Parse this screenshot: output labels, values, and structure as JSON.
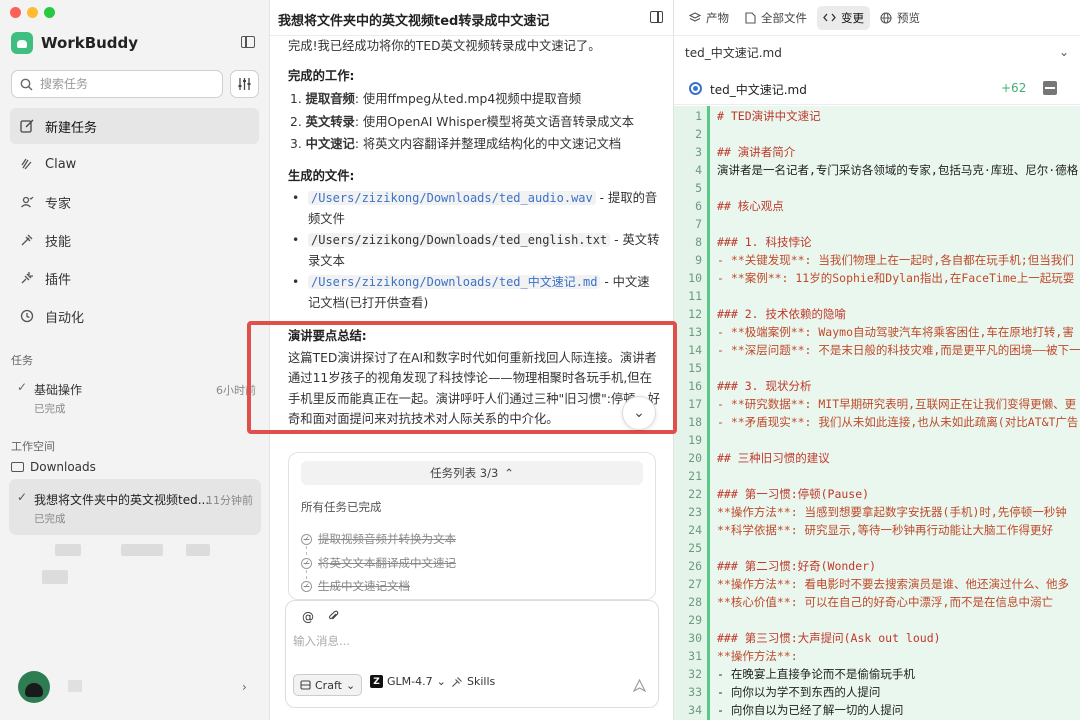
{
  "sidebar": {
    "brand": "WorkBuddy",
    "search_placeholder": "搜索任务",
    "nav": [
      {
        "label": "新建任务",
        "icon": "edit-icon"
      },
      {
        "label": "Claw",
        "icon": "claw-icon"
      },
      {
        "label": "专家",
        "icon": "experts-icon"
      },
      {
        "label": "技能",
        "icon": "skills-icon"
      },
      {
        "label": "插件",
        "icon": "plugin-icon"
      },
      {
        "label": "自动化",
        "icon": "clock-icon"
      }
    ],
    "tasks_label": "任务",
    "task": {
      "title": "基础操作",
      "time": "6小时前",
      "status": "已完成"
    },
    "workspace_label": "工作空间",
    "folder": "Downloads",
    "session": {
      "title": "我想将文件夹中的英文视频ted...",
      "time": "11分钟前",
      "status": "已完成"
    }
  },
  "chat": {
    "title": "我想将文件夹中的英文视频ted转录成中文速记",
    "intro": "完成!我已经成功将你的TED英文视频转录成中文速记了。",
    "work_heading": "完成的工作:",
    "steps": [
      {
        "num": "1.",
        "bold": "提取音频",
        "text": ": 使用ffmpeg从ted.mp4视频中提取音频"
      },
      {
        "num": "2.",
        "bold": "英文转录",
        "text": ": 使用OpenAI Whisper模型将英文语音转录成文本"
      },
      {
        "num": "3.",
        "bold": "中文速记",
        "text": ": 将英文内容翻译并整理成结构化的中文速记文档"
      }
    ],
    "files_heading": "生成的文件:",
    "files": [
      {
        "path": "/Users/zizikong/Downloads/ted_audio.wav",
        "desc": " - 提取的音频文件"
      },
      {
        "path": "/Users/zizikong/Downloads/ted_english.txt",
        "desc": " - 英文转录文本"
      },
      {
        "path": "/Users/zizikong/Downloads/ted_中文速记.md",
        "desc": " - 中文速记文档(已打开供查看)"
      }
    ],
    "summary_heading": "演讲要点总结:",
    "summary_text": "这篇TED演讲探讨了在AI和数字时代如何重新找回人际连接。演讲者通过11岁孩子的视角发现了科技悖论——物理相聚时各玩手机,但在手机里反而能真正在一起。演讲呼吁人们通过三种\"旧习惯\":停顿、好奇和面对面提问来对抗技术对人际关系的中介化。",
    "task_card": {
      "header": "任务列表 3/3",
      "status": "所有任务已完成",
      "items": [
        "提取视频音频并转换为文本",
        "将英文文本翻译成中文速记",
        "生成中文速记文档"
      ]
    },
    "composer": {
      "placeholder": "输入消息...",
      "mode": "Craft",
      "model": "GLM-4.7",
      "skills": "Skills"
    }
  },
  "right": {
    "tabs": [
      {
        "label": "产物",
        "icon": "layers-icon",
        "active": false
      },
      {
        "label": "全部文件",
        "icon": "file-icon",
        "active": false
      },
      {
        "label": "变更",
        "icon": "code-icon",
        "active": true
      },
      {
        "label": "预览",
        "icon": "globe-icon",
        "active": false
      }
    ],
    "selected_file": "ted_中文速记.md",
    "file_name": "ted_中文速记.md",
    "additions": "+62",
    "lines": [
      {
        "n": "1",
        "t": "# TED演讲中文速记",
        "k": "h"
      },
      {
        "n": "2",
        "t": "",
        "k": ""
      },
      {
        "n": "3",
        "t": "## 演讲者简介",
        "k": "h"
      },
      {
        "n": "4",
        "t": "演讲者是一名记者,专门采访各领域的专家,包括马克·库班、尼尔·德格",
        "k": ""
      },
      {
        "n": "5",
        "t": "",
        "k": ""
      },
      {
        "n": "6",
        "t": "## 核心观点",
        "k": "h"
      },
      {
        "n": "7",
        "t": "",
        "k": ""
      },
      {
        "n": "8",
        "t": "### 1. 科技悖论",
        "k": "h"
      },
      {
        "n": "9",
        "t": "- **关键发现**: 当我们物理上在一起时,各自都在玩手机;但当我们",
        "k": "b"
      },
      {
        "n": "10",
        "t": "- **案例**: 11岁的Sophie和Dylan指出,在FaceTime上一起玩耍",
        "k": "b"
      },
      {
        "n": "11",
        "t": "",
        "k": ""
      },
      {
        "n": "12",
        "t": "### 2. 技术依赖的隐喻",
        "k": "h"
      },
      {
        "n": "13",
        "t": "- **极端案例**: Waymo自动驾驶汽车将乘客困住,车在原地打转,害",
        "k": "b"
      },
      {
        "n": "14",
        "t": "- **深层问题**: 不是末日般的科技灾难,而是更平凡的困境——被下一",
        "k": "b"
      },
      {
        "n": "15",
        "t": "",
        "k": ""
      },
      {
        "n": "16",
        "t": "### 3. 现状分析",
        "k": "h"
      },
      {
        "n": "17",
        "t": "- **研究数据**: MIT早期研究表明,互联网正在让我们变得更懒、更",
        "k": "b"
      },
      {
        "n": "18",
        "t": "- **矛盾现实**: 我们从未如此连接,也从未如此疏离(对比AT&T广告",
        "k": "b"
      },
      {
        "n": "19",
        "t": "",
        "k": ""
      },
      {
        "n": "20",
        "t": "## 三种旧习惯的建议",
        "k": "h"
      },
      {
        "n": "21",
        "t": "",
        "k": ""
      },
      {
        "n": "22",
        "t": "### 第一习惯:停顿(Pause)",
        "k": "h"
      },
      {
        "n": "23",
        "t": "**操作方法**: 当感到想要拿起数字安抚器(手机)时,先停顿一秒钟",
        "k": "b"
      },
      {
        "n": "24",
        "t": "**科学依据**: 研究显示,等待一秒钟再行动能让大脑工作得更好",
        "k": "b"
      },
      {
        "n": "25",
        "t": "",
        "k": ""
      },
      {
        "n": "26",
        "t": "### 第二习惯:好奇(Wonder)",
        "k": "h"
      },
      {
        "n": "27",
        "t": "**操作方法**: 看电影时不要去搜索演员是谁、他还演过什么、他多",
        "k": "b"
      },
      {
        "n": "28",
        "t": "**核心价值**: 可以在自己的好奇心中漂浮,而不是在信息中溺亡",
        "k": "b"
      },
      {
        "n": "29",
        "t": "",
        "k": ""
      },
      {
        "n": "30",
        "t": "### 第三习惯:大声提问(Ask out loud)",
        "k": "h"
      },
      {
        "n": "31",
        "t": "**操作方法**:",
        "k": "b"
      },
      {
        "n": "32",
        "t": "- 在晚宴上直接争论而不是偷偷玩手机",
        "k": ""
      },
      {
        "n": "33",
        "t": "- 向你以为学不到东西的人提问",
        "k": ""
      },
      {
        "n": "34",
        "t": "- 向你自以为已经了解一切的人提问",
        "k": ""
      }
    ]
  },
  "colors": {
    "accent_red": "#e0504a",
    "diff_green": "#5bc786",
    "link_blue": "#3b73c9"
  }
}
